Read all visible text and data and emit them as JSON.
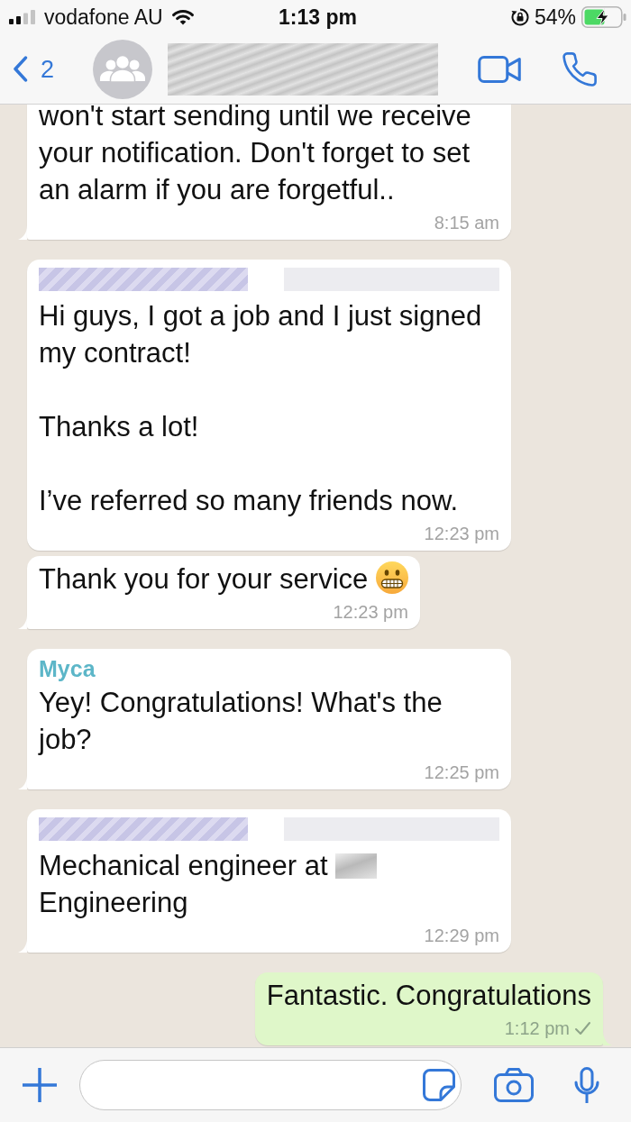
{
  "status_bar": {
    "carrier": "vodafone AU",
    "time": "1:13 pm",
    "battery": "54%"
  },
  "header": {
    "back_count": "2",
    "title_hidden": true
  },
  "messages": [
    {
      "kind": "incoming",
      "sender_hidden": false,
      "tail": true,
      "paragraphs": [
        [
          {
            "kind": "text",
            "text": "won't start sending until we receive your notification. Don't forget to set an alarm if you are forgetful.."
          }
        ]
      ],
      "time": "8:15 am"
    },
    {
      "kind": "incoming",
      "sender_hidden": true,
      "tail": false,
      "paragraphs": [
        [
          {
            "kind": "text",
            "text": "Hi guys, I got a job and I just signed my contract!"
          }
        ],
        [
          {
            "kind": "text",
            "text": "Thanks a lot!"
          }
        ],
        [
          {
            "kind": "text",
            "text": "I’ve referred so many friends now."
          }
        ]
      ],
      "time": "12:23 pm"
    },
    {
      "kind": "incoming",
      "sender_hidden": false,
      "tail": true,
      "paragraphs": [
        [
          {
            "kind": "text",
            "text": "Thank you for your service"
          },
          {
            "kind": "emoji"
          }
        ]
      ],
      "time": "12:23 pm"
    },
    {
      "kind": "incoming",
      "sender_hidden": false,
      "sender": "Myca",
      "color": "#5cb6c8",
      "tail": true,
      "paragraphs": [
        [
          {
            "kind": "text",
            "text": "Yey! Congratulations! What's the job?"
          }
        ]
      ],
      "time": "12:25 pm"
    },
    {
      "kind": "incoming",
      "sender_hidden": true,
      "tail": true,
      "paragraphs": [
        [
          {
            "kind": "text",
            "text": "Mechanical engineer at"
          },
          {
            "kind": "redacted"
          },
          {
            "kind": "text",
            "text": "Engineering"
          }
        ]
      ],
      "time": "12:29 pm"
    },
    {
      "kind": "outgoing",
      "sender_hidden": false,
      "tail": true,
      "paragraphs": [
        [
          {
            "kind": "text",
            "text": "Fantastic. Congratulations"
          }
        ]
      ],
      "time": "1:12 pm",
      "delivered": false,
      "read": false
    }
  ]
}
